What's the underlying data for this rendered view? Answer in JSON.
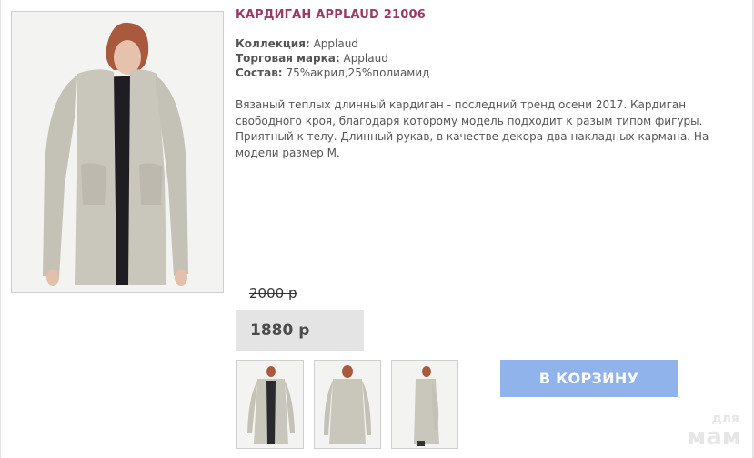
{
  "product": {
    "title": "КАРДИГАН APPLAUD 21006",
    "specs": [
      {
        "label": "Коллекция:",
        "value": "Applaud"
      },
      {
        "label": "Торговая марка:",
        "value": "Applaud"
      },
      {
        "label": "Состав:",
        "value": "75%акрил,25%полиамид"
      }
    ],
    "description": "Вязаный теплых длинный кардиган - последний тренд осени 2017. Кардиган свободного кроя, благодаря которому модель подходит к разым типом фигуры. Приятный к телу. Длинный рукав, в качестве декора два накладных кармана. На модели размер М.",
    "old_price": "2000 р",
    "price": "1880 р",
    "cart_button": "В КОРЗИНУ"
  },
  "watermark": {
    "top": "для",
    "bottom": "мам"
  },
  "colors": {
    "title": "#9a3b66",
    "button": "#8fb3ea",
    "price_box": "#e4e4e4"
  }
}
